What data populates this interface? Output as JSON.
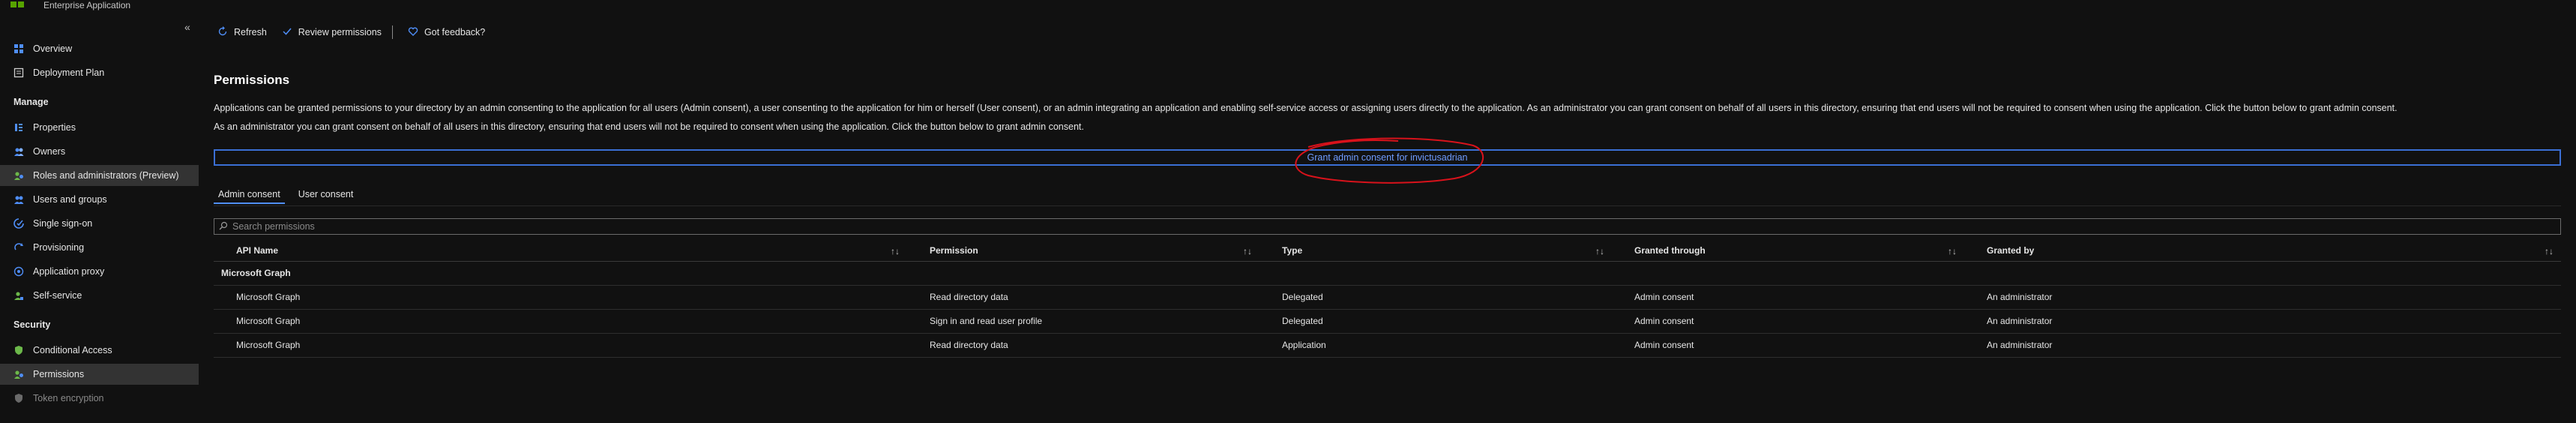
{
  "app": {
    "subtitle": "Enterprise Application",
    "collapse_glyph": "«"
  },
  "sidebar": {
    "items_top": [
      {
        "label": "Overview",
        "icon": "grid-icon"
      },
      {
        "label": "Deployment Plan",
        "icon": "book-icon"
      }
    ],
    "manage_title": "Manage",
    "manage_items": [
      {
        "label": "Properties",
        "icon": "properties-icon"
      },
      {
        "label": "Owners",
        "icon": "people-icon"
      },
      {
        "label": "Roles and administrators (Preview)",
        "icon": "roles-icon"
      },
      {
        "label": "Users and groups",
        "icon": "users-groups-icon"
      },
      {
        "label": "Single sign-on",
        "icon": "sso-icon"
      },
      {
        "label": "Provisioning",
        "icon": "provisioning-icon"
      },
      {
        "label": "Application proxy",
        "icon": "app-proxy-icon"
      },
      {
        "label": "Self-service",
        "icon": "self-service-icon"
      }
    ],
    "security_title": "Security",
    "security_items": [
      {
        "label": "Conditional Access",
        "icon": "conditional-access-icon"
      },
      {
        "label": "Permissions",
        "icon": "permissions-icon"
      },
      {
        "label": "Token encryption",
        "icon": "shield-icon"
      }
    ]
  },
  "toolbar": {
    "refresh": "Refresh",
    "review": "Review permissions",
    "feedback": "Got feedback?"
  },
  "main": {
    "title": "Permissions",
    "description1": "Applications can be granted permissions to your directory by an admin consenting to the application for all users (Admin consent), a user consenting to the application for him or herself (User consent), or an admin integrating an application and enabling self-service access or assigning users directly to the application. As an administrator you can grant consent on behalf of all users in this directory, ensuring that end users will not be required to consent when using the application. Click the button below to grant admin consent.",
    "description2": "As an administrator you can grant consent on behalf of all users in this directory, ensuring that end users will not be required to consent when using the application. Click the button below to grant admin consent.",
    "grant_button": "Grant admin consent for invictusadrian",
    "tabs": [
      "Admin consent",
      "User consent"
    ],
    "search_placeholder": "Search permissions"
  },
  "table": {
    "columns": [
      "API Name",
      "Permission",
      "Type",
      "Granted through",
      "Granted by"
    ],
    "sort_glyph": "↑↓",
    "group": "Microsoft Graph",
    "rows": [
      [
        "Microsoft Graph",
        "Read directory data",
        "Delegated",
        "Admin consent",
        "An administrator"
      ],
      [
        "Microsoft Graph",
        "Sign in and read user profile",
        "Delegated",
        "Admin consent",
        "An administrator"
      ],
      [
        "Microsoft Graph",
        "Read directory data",
        "Application",
        "Admin consent",
        "An administrator"
      ]
    ]
  },
  "colors": {
    "accent": "#3b6fd4",
    "link": "#6f9cff",
    "annotation": "#d8121b",
    "selected_bg": "#333333"
  }
}
